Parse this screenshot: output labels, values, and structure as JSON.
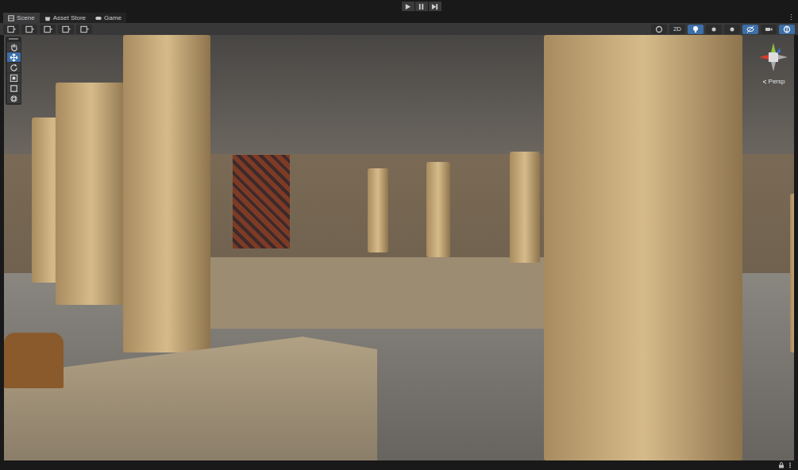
{
  "playbar": {
    "buttons": [
      {
        "kind": "play",
        "on": false
      },
      {
        "kind": "pause",
        "on": false
      },
      {
        "kind": "step",
        "on": false
      }
    ]
  },
  "tabs": [
    {
      "label": "Scene",
      "kind": "scene",
      "selected": true
    },
    {
      "label": "Asset Store",
      "kind": "store",
      "selected": false
    },
    {
      "label": "Game",
      "kind": "game",
      "selected": false
    }
  ],
  "toolbar_left": [
    {
      "kind": "shading",
      "on": false
    },
    {
      "kind": "draw",
      "on": false
    },
    {
      "kind": "grid",
      "on": false
    },
    {
      "kind": "snap",
      "on": false
    },
    {
      "kind": "increment",
      "on": false
    }
  ],
  "toolbar_right": [
    {
      "kind": "orbit",
      "label": "",
      "on": false
    },
    {
      "kind": "text",
      "label": "2D",
      "on": false
    },
    {
      "kind": "light",
      "label": "",
      "on": true
    },
    {
      "kind": "audio",
      "label": "",
      "on": false
    },
    {
      "kind": "fx",
      "label": "",
      "on": false
    },
    {
      "kind": "hidden",
      "label": "",
      "on": true
    },
    {
      "kind": "camera",
      "label": "",
      "on": false
    },
    {
      "kind": "gizmos",
      "label": "",
      "on": true
    }
  ],
  "tools": [
    {
      "kind": "hand",
      "selected": false
    },
    {
      "kind": "move",
      "selected": true
    },
    {
      "kind": "rotate",
      "selected": false
    },
    {
      "kind": "scale",
      "selected": false
    },
    {
      "kind": "rect",
      "selected": false
    },
    {
      "kind": "transform",
      "selected": false
    }
  ],
  "gizmo": {
    "label": "Persp"
  },
  "status_bar": {
    "icons": [
      {
        "kind": "lock"
      },
      {
        "kind": "menu"
      }
    ]
  }
}
